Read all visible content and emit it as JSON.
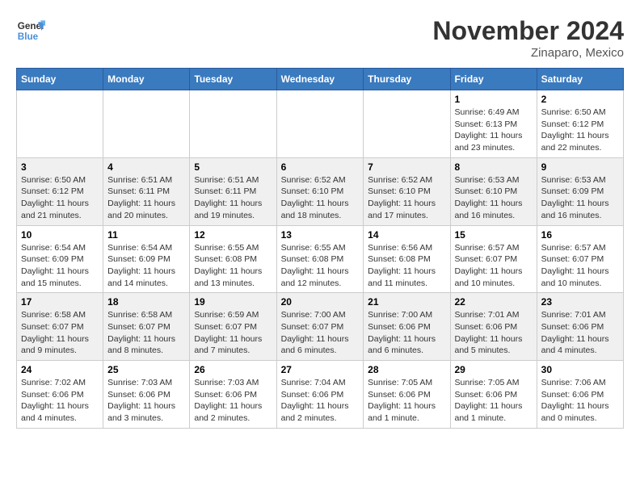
{
  "header": {
    "logo_line1": "General",
    "logo_line2": "Blue",
    "month": "November 2024",
    "location": "Zinaparo, Mexico"
  },
  "weekdays": [
    "Sunday",
    "Monday",
    "Tuesday",
    "Wednesday",
    "Thursday",
    "Friday",
    "Saturday"
  ],
  "weeks": [
    [
      {
        "day": "",
        "info": ""
      },
      {
        "day": "",
        "info": ""
      },
      {
        "day": "",
        "info": ""
      },
      {
        "day": "",
        "info": ""
      },
      {
        "day": "",
        "info": ""
      },
      {
        "day": "1",
        "info": "Sunrise: 6:49 AM\nSunset: 6:13 PM\nDaylight: 11 hours and 23 minutes."
      },
      {
        "day": "2",
        "info": "Sunrise: 6:50 AM\nSunset: 6:12 PM\nDaylight: 11 hours and 22 minutes."
      }
    ],
    [
      {
        "day": "3",
        "info": "Sunrise: 6:50 AM\nSunset: 6:12 PM\nDaylight: 11 hours and 21 minutes."
      },
      {
        "day": "4",
        "info": "Sunrise: 6:51 AM\nSunset: 6:11 PM\nDaylight: 11 hours and 20 minutes."
      },
      {
        "day": "5",
        "info": "Sunrise: 6:51 AM\nSunset: 6:11 PM\nDaylight: 11 hours and 19 minutes."
      },
      {
        "day": "6",
        "info": "Sunrise: 6:52 AM\nSunset: 6:10 PM\nDaylight: 11 hours and 18 minutes."
      },
      {
        "day": "7",
        "info": "Sunrise: 6:52 AM\nSunset: 6:10 PM\nDaylight: 11 hours and 17 minutes."
      },
      {
        "day": "8",
        "info": "Sunrise: 6:53 AM\nSunset: 6:10 PM\nDaylight: 11 hours and 16 minutes."
      },
      {
        "day": "9",
        "info": "Sunrise: 6:53 AM\nSunset: 6:09 PM\nDaylight: 11 hours and 16 minutes."
      }
    ],
    [
      {
        "day": "10",
        "info": "Sunrise: 6:54 AM\nSunset: 6:09 PM\nDaylight: 11 hours and 15 minutes."
      },
      {
        "day": "11",
        "info": "Sunrise: 6:54 AM\nSunset: 6:09 PM\nDaylight: 11 hours and 14 minutes."
      },
      {
        "day": "12",
        "info": "Sunrise: 6:55 AM\nSunset: 6:08 PM\nDaylight: 11 hours and 13 minutes."
      },
      {
        "day": "13",
        "info": "Sunrise: 6:55 AM\nSunset: 6:08 PM\nDaylight: 11 hours and 12 minutes."
      },
      {
        "day": "14",
        "info": "Sunrise: 6:56 AM\nSunset: 6:08 PM\nDaylight: 11 hours and 11 minutes."
      },
      {
        "day": "15",
        "info": "Sunrise: 6:57 AM\nSunset: 6:07 PM\nDaylight: 11 hours and 10 minutes."
      },
      {
        "day": "16",
        "info": "Sunrise: 6:57 AM\nSunset: 6:07 PM\nDaylight: 11 hours and 10 minutes."
      }
    ],
    [
      {
        "day": "17",
        "info": "Sunrise: 6:58 AM\nSunset: 6:07 PM\nDaylight: 11 hours and 9 minutes."
      },
      {
        "day": "18",
        "info": "Sunrise: 6:58 AM\nSunset: 6:07 PM\nDaylight: 11 hours and 8 minutes."
      },
      {
        "day": "19",
        "info": "Sunrise: 6:59 AM\nSunset: 6:07 PM\nDaylight: 11 hours and 7 minutes."
      },
      {
        "day": "20",
        "info": "Sunrise: 7:00 AM\nSunset: 6:07 PM\nDaylight: 11 hours and 6 minutes."
      },
      {
        "day": "21",
        "info": "Sunrise: 7:00 AM\nSunset: 6:06 PM\nDaylight: 11 hours and 6 minutes."
      },
      {
        "day": "22",
        "info": "Sunrise: 7:01 AM\nSunset: 6:06 PM\nDaylight: 11 hours and 5 minutes."
      },
      {
        "day": "23",
        "info": "Sunrise: 7:01 AM\nSunset: 6:06 PM\nDaylight: 11 hours and 4 minutes."
      }
    ],
    [
      {
        "day": "24",
        "info": "Sunrise: 7:02 AM\nSunset: 6:06 PM\nDaylight: 11 hours and 4 minutes."
      },
      {
        "day": "25",
        "info": "Sunrise: 7:03 AM\nSunset: 6:06 PM\nDaylight: 11 hours and 3 minutes."
      },
      {
        "day": "26",
        "info": "Sunrise: 7:03 AM\nSunset: 6:06 PM\nDaylight: 11 hours and 2 minutes."
      },
      {
        "day": "27",
        "info": "Sunrise: 7:04 AM\nSunset: 6:06 PM\nDaylight: 11 hours and 2 minutes."
      },
      {
        "day": "28",
        "info": "Sunrise: 7:05 AM\nSunset: 6:06 PM\nDaylight: 11 hours and 1 minute."
      },
      {
        "day": "29",
        "info": "Sunrise: 7:05 AM\nSunset: 6:06 PM\nDaylight: 11 hours and 1 minute."
      },
      {
        "day": "30",
        "info": "Sunrise: 7:06 AM\nSunset: 6:06 PM\nDaylight: 11 hours and 0 minutes."
      }
    ]
  ]
}
